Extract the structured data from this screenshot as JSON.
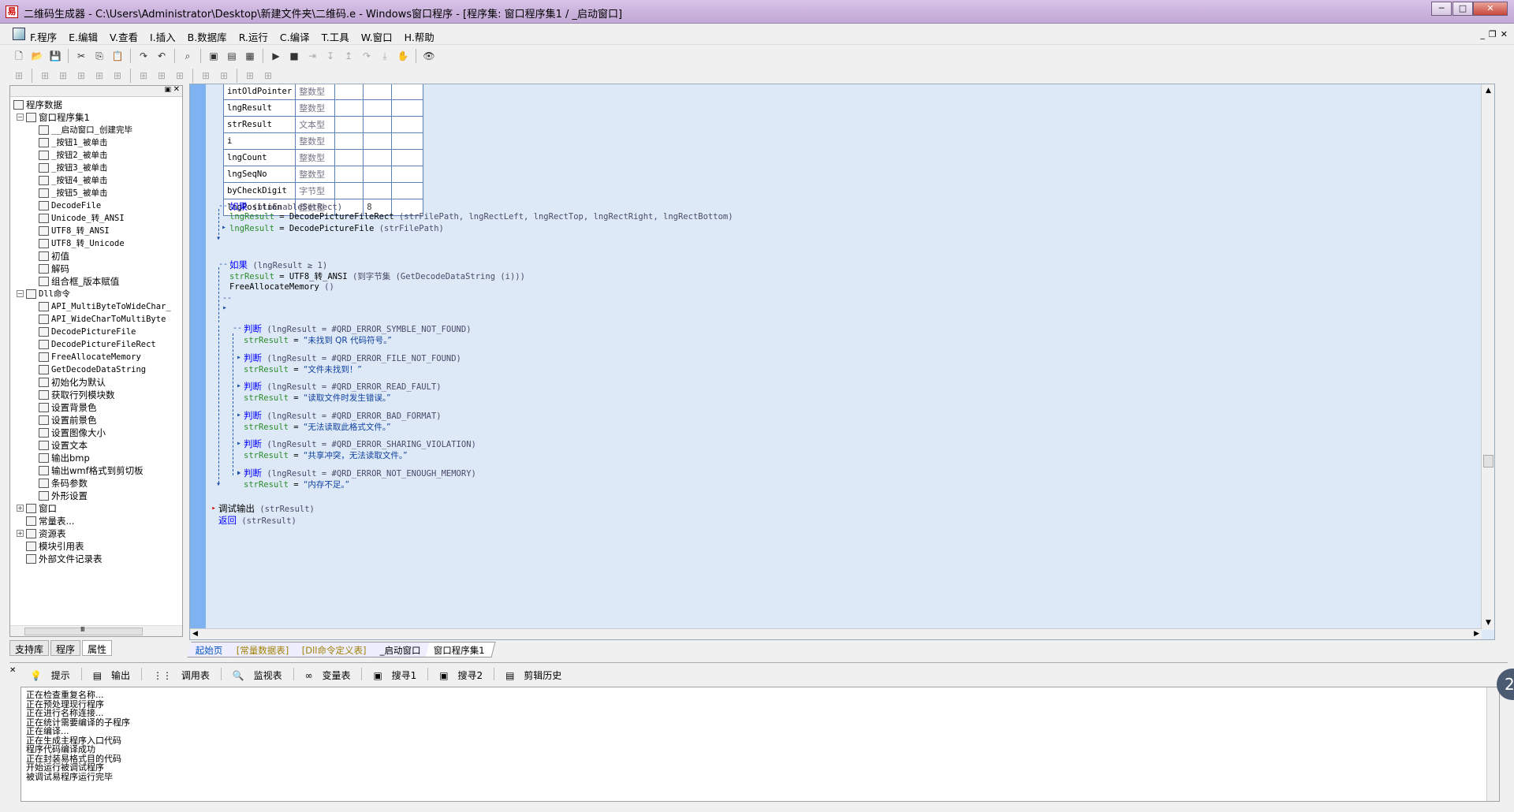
{
  "window": {
    "title": "二维码生成器 - C:\\Users\\Administrator\\Desktop\\新建文件夹\\二维码.e - Windows窗口程序 - [程序集: 窗口程序集1 / _启动窗口]",
    "min": "─",
    "max": "□",
    "close": "✕"
  },
  "menu": [
    "F.程序",
    "E.编辑",
    "V.查看",
    "I.插入",
    "B.数据库",
    "R.运行",
    "C.编译",
    "T.工具",
    "W.窗口",
    "H.帮助"
  ],
  "mdi": {
    "min": "_",
    "restore": "❐",
    "close": "✕"
  },
  "toolbar1": [
    {
      "icon": "new-icon",
      "glyph": "🗋"
    },
    {
      "icon": "open-icon",
      "glyph": "📂"
    },
    {
      "icon": "save-icon",
      "glyph": "💾"
    },
    {
      "icon": "cut-icon",
      "glyph": "✂"
    },
    {
      "icon": "copy-icon",
      "glyph": "⎘"
    },
    {
      "icon": "paste-icon",
      "glyph": "📋"
    },
    {
      "icon": "redo-icon",
      "glyph": "↷"
    },
    {
      "icon": "undo-icon",
      "glyph": "↶"
    },
    {
      "icon": "find-icon",
      "glyph": "⌕"
    },
    {
      "icon": "window-layout-1-icon",
      "glyph": "▣"
    },
    {
      "icon": "window-layout-2-icon",
      "glyph": "▤"
    },
    {
      "icon": "window-layout-3-icon",
      "glyph": "▦"
    },
    {
      "icon": "run-icon",
      "glyph": "▶"
    },
    {
      "icon": "stop-icon",
      "glyph": "■"
    },
    {
      "icon": "step-icon",
      "glyph": "⇥"
    },
    {
      "icon": "step-into-icon",
      "glyph": "↧"
    },
    {
      "icon": "step-out-icon",
      "glyph": "↥"
    },
    {
      "icon": "step-over-icon",
      "glyph": "↷"
    },
    {
      "icon": "run-to-icon",
      "glyph": "⤓"
    },
    {
      "icon": "hand-icon",
      "glyph": "✋"
    },
    {
      "icon": "binoculars-icon",
      "glyph": "👁"
    }
  ],
  "toolbar2": [
    "align-left-icon",
    "align-top-icon",
    "align-center-icon",
    "align-right-icon",
    "align-bottom-icon",
    "same-width-icon",
    "same-height-icon",
    "same-size-icon",
    "space-h-icon",
    "space-v-icon",
    "center-h-icon",
    "center-v-icon",
    "grid-icon"
  ],
  "left_panel": {
    "pin": "▣",
    "close": "✕",
    "tree": [
      {
        "level": 0,
        "exp": "",
        "icon": "program-data-icon",
        "label": "程序数据"
      },
      {
        "level": 1,
        "exp": "−",
        "icon": "assembly-icon",
        "label": "窗口程序集1"
      },
      {
        "level": 2,
        "exp": "",
        "icon": "sub-icon",
        "label": "__启动窗口_创建完毕"
      },
      {
        "level": 2,
        "exp": "",
        "icon": "sub-icon",
        "label": "_按钮1_被单击"
      },
      {
        "level": 2,
        "exp": "",
        "icon": "sub-icon",
        "label": "_按钮2_被单击"
      },
      {
        "level": 2,
        "exp": "",
        "icon": "sub-icon",
        "label": "_按钮3_被单击"
      },
      {
        "level": 2,
        "exp": "",
        "icon": "sub-icon",
        "label": "_按钮4_被单击"
      },
      {
        "level": 2,
        "exp": "",
        "icon": "sub-icon",
        "label": "_按钮5_被单击"
      },
      {
        "level": 2,
        "exp": "",
        "icon": "sub-icon",
        "label": "DecodeFile"
      },
      {
        "level": 2,
        "exp": "",
        "icon": "sub-icon",
        "label": "Unicode_转_ANSI"
      },
      {
        "level": 2,
        "exp": "",
        "icon": "sub-icon",
        "label": "UTF8_转_ANSI"
      },
      {
        "level": 2,
        "exp": "",
        "icon": "sub-icon",
        "label": "UTF8_转_Unicode"
      },
      {
        "level": 2,
        "exp": "",
        "icon": "sub-icon",
        "label": "初值"
      },
      {
        "level": 2,
        "exp": "",
        "icon": "sub-icon",
        "label": "解码"
      },
      {
        "level": 2,
        "exp": "",
        "icon": "sub-icon",
        "label": "组合框_版本赋值"
      },
      {
        "level": 1,
        "exp": "−",
        "icon": "dll-icon",
        "label": "Dll命令"
      },
      {
        "level": 2,
        "exp": "",
        "icon": "dll-cmd-icon",
        "label": "API_MultiByteToWideChar_"
      },
      {
        "level": 2,
        "exp": "",
        "icon": "dll-cmd-icon",
        "label": "API_WideCharToMultiByte"
      },
      {
        "level": 2,
        "exp": "",
        "icon": "dll-cmd-icon",
        "label": "DecodePictureFile"
      },
      {
        "level": 2,
        "exp": "",
        "icon": "dll-cmd-icon",
        "label": "DecodePictureFileRect"
      },
      {
        "level": 2,
        "exp": "",
        "icon": "dll-cmd-icon",
        "label": "FreeAllocateMemory"
      },
      {
        "level": 2,
        "exp": "",
        "icon": "dll-cmd-icon",
        "label": "GetDecodeDataString"
      },
      {
        "level": 2,
        "exp": "",
        "icon": "dll-cmd-icon",
        "label": "初始化为默认"
      },
      {
        "level": 2,
        "exp": "",
        "icon": "dll-cmd-icon",
        "label": "获取行列模块数"
      },
      {
        "level": 2,
        "exp": "",
        "icon": "dll-cmd-icon",
        "label": "设置背景色"
      },
      {
        "level": 2,
        "exp": "",
        "icon": "dll-cmd-icon",
        "label": "设置前景色"
      },
      {
        "level": 2,
        "exp": "",
        "icon": "dll-cmd-icon",
        "label": "设置图像大小"
      },
      {
        "level": 2,
        "exp": "",
        "icon": "dll-cmd-icon",
        "label": "设置文本"
      },
      {
        "level": 2,
        "exp": "",
        "icon": "dll-cmd-icon",
        "label": "输出bmp"
      },
      {
        "level": 2,
        "exp": "",
        "icon": "dll-cmd-icon",
        "label": "输出wmf格式到剪切板"
      },
      {
        "level": 2,
        "exp": "",
        "icon": "dll-cmd-icon",
        "label": "条码参数"
      },
      {
        "level": 2,
        "exp": "",
        "icon": "dll-cmd-icon",
        "label": "外形设置"
      },
      {
        "level": 1,
        "exp": "+",
        "icon": "window-icon",
        "label": "窗口"
      },
      {
        "level": 1,
        "exp": "",
        "icon": "constants-icon",
        "label": "常量表..."
      },
      {
        "level": 1,
        "exp": "+",
        "icon": "resources-icon",
        "label": "资源表"
      },
      {
        "level": 1,
        "exp": "",
        "icon": "module-ref-icon",
        "label": "模块引用表"
      },
      {
        "level": 1,
        "exp": "",
        "icon": "external-file-icon",
        "label": "外部文件记录表"
      }
    ],
    "hscroll_mark": "Ⅲ",
    "tabs": [
      "支持库",
      "程序",
      "属性"
    ]
  },
  "vars": [
    {
      "name": "intOldPointer",
      "type": "整数型",
      "extra": ""
    },
    {
      "name": "lngResult",
      "type": "整数型",
      "extra": ""
    },
    {
      "name": "strResult",
      "type": "文本型",
      "extra": ""
    },
    {
      "name": "i",
      "type": "整数型",
      "extra": ""
    },
    {
      "name": "lngCount",
      "type": "整数型",
      "extra": ""
    },
    {
      "name": "lngSeqNo",
      "type": "整数型",
      "extra": ""
    },
    {
      "name": "byCheckDigit",
      "type": "字节型",
      "extra": ""
    },
    {
      "name": "lngPosition",
      "type": "整数型",
      "extra": "8"
    }
  ],
  "code": {
    "if1": {
      "kw": "如果",
      "cond": "(blnEnableSetRect)"
    },
    "l1": {
      "var": "lngResult",
      "eq": "=",
      "fn": "DecodePictureFileRect",
      "args": "(strFilePath, lngRectLeft, lngRectTop, lngRectRight, lngRectBottom)"
    },
    "l2": {
      "var": "lngResult",
      "eq": "=",
      "fn": "DecodePictureFile",
      "args": "(strFilePath)"
    },
    "if2": {
      "kw": "如果",
      "cond": "(lngResult ≥ 1)"
    },
    "l3": {
      "var": "strResult",
      "eq": "=",
      "fn": "UTF8_转_ANSI",
      "args": "(到字节集 (GetDecodeDataString (i)))"
    },
    "l4": {
      "fn": "FreeAllocateMemory",
      "args": "()"
    },
    "judges": [
      {
        "kw": "判断",
        "cond": "(lngResult = #QRD_ERROR_SYMBLE_NOT_FOUND)",
        "var": "strResult",
        "eq": "=",
        "str": "“未找到 QR 代码符号。”"
      },
      {
        "kw": "判断",
        "cond": "(lngResult = #QRD_ERROR_FILE_NOT_FOUND)",
        "var": "strResult",
        "eq": "=",
        "str": "“文件未找到！”"
      },
      {
        "kw": "判断",
        "cond": "(lngResult = #QRD_ERROR_READ_FAULT)",
        "var": "strResult",
        "eq": "=",
        "str": "“读取文件时发生错误。”"
      },
      {
        "kw": "判断",
        "cond": "(lngResult = #QRD_ERROR_BAD_FORMAT)",
        "var": "strResult",
        "eq": "=",
        "str": "“无法读取此格式文件。”"
      },
      {
        "kw": "判断",
        "cond": "(lngResult = #QRD_ERROR_SHARING_VIOLATION)",
        "var": "strResult",
        "eq": "=",
        "str": "“共享冲突，无法读取文件。”"
      },
      {
        "kw": "判断",
        "cond": "(lngResult = #QRD_ERROR_NOT_ENOUGH_MEMORY)",
        "var": "strResult",
        "eq": "=",
        "str": "“内存不足。”"
      }
    ],
    "debug": {
      "kw": "调试输出",
      "args": "(strResult)"
    },
    "ret": {
      "kw": "返回",
      "args": "(strResult)"
    }
  },
  "editor_tabs": [
    "起始页",
    "[常量数据表]",
    "[Dll命令定义表]",
    "_启动窗口",
    "窗口程序集1"
  ],
  "bottom_tabs": [
    {
      "icon": "hint-icon",
      "glyph": "💡",
      "label": "提示"
    },
    {
      "icon": "output-icon",
      "glyph": "▤",
      "label": "输出"
    },
    {
      "icon": "call-table-icon",
      "glyph": "⋮⋮",
      "label": "调用表"
    },
    {
      "icon": "watch-icon",
      "glyph": "🔍",
      "label": "监视表"
    },
    {
      "icon": "variables-icon",
      "glyph": "∞",
      "label": "变量表"
    },
    {
      "icon": "search1-icon",
      "glyph": "▣",
      "label": "搜寻1"
    },
    {
      "icon": "search2-icon",
      "glyph": "▣",
      "label": "搜寻2"
    },
    {
      "icon": "clip-history-icon",
      "glyph": "▤",
      "label": "剪辑历史"
    }
  ],
  "output_lines": [
    "正在检查重复名称...",
    "正在预处理现行程序",
    "正在进行名称连接...",
    "正在统计需要编译的子程序",
    "正在编译...",
    "正在生成主程序入口代码",
    "程序代码编译成功",
    "正在封装易格式目的代码",
    "开始运行被调试程序",
    "被调试易程序运行完毕"
  ],
  "badge": "2"
}
